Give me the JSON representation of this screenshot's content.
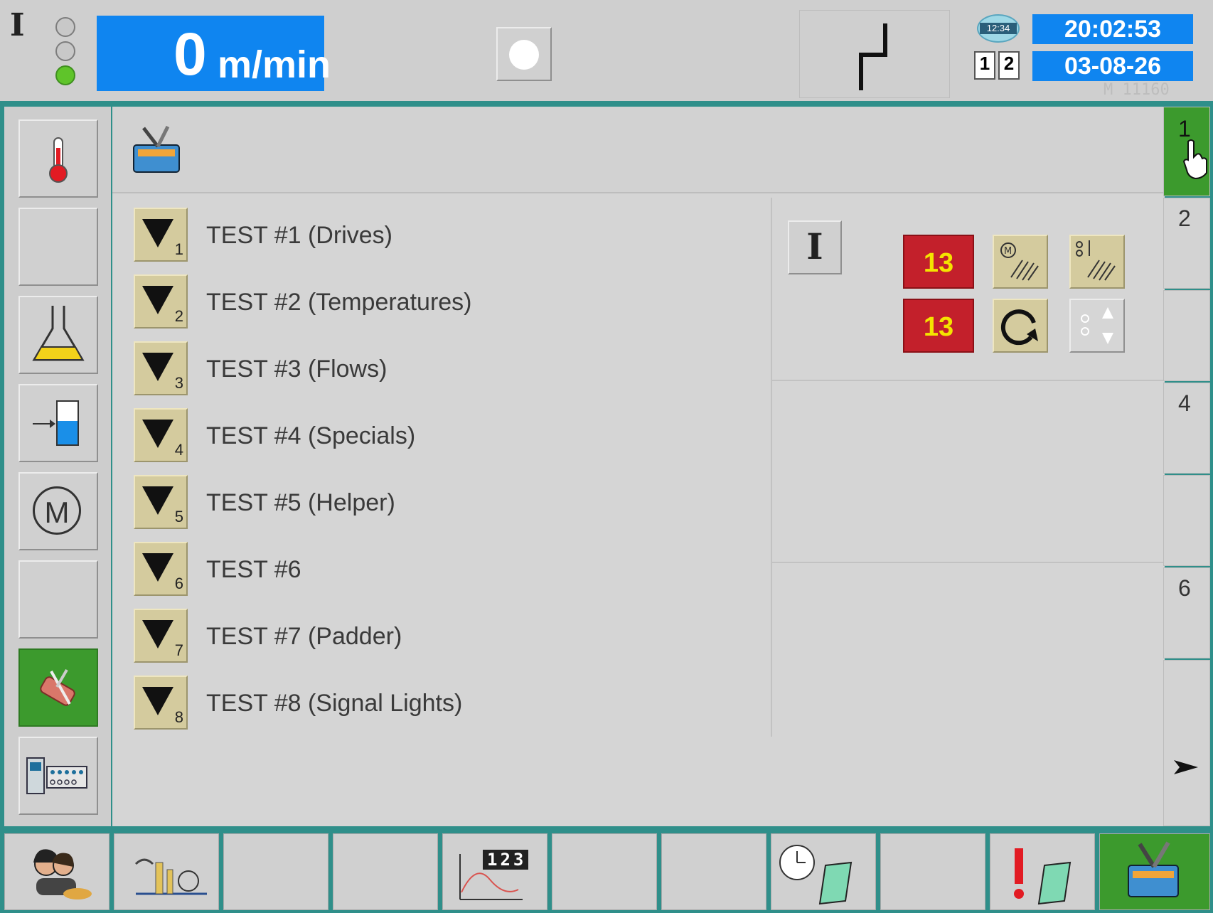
{
  "topbar": {
    "mode_symbol": "I",
    "speed_value": "0",
    "speed_unit": "m/min",
    "time": "20:02:53",
    "date": "03-08-26",
    "clock_icon_text": "12:34",
    "dual_icon_left": "1",
    "dual_icon_right": "2",
    "machine_id": "M 11160"
  },
  "sidebar": {
    "items": [
      {
        "icon": "thermometer-icon"
      },
      {
        "icon": "empty"
      },
      {
        "icon": "flask-icon"
      },
      {
        "icon": "tank-fill-icon"
      },
      {
        "icon": "motor-icon",
        "symbol": "M"
      },
      {
        "icon": "empty"
      },
      {
        "icon": "tools-icon",
        "active": true
      },
      {
        "icon": "control-panel-icon"
      }
    ]
  },
  "tests": [
    {
      "num": "1",
      "label": "TEST #1 (Drives)"
    },
    {
      "num": "2",
      "label": "TEST #2 (Temperatures)"
    },
    {
      "num": "3",
      "label": "TEST #3 (Flows)"
    },
    {
      "num": "4",
      "label": "TEST #4 (Specials)"
    },
    {
      "num": "5",
      "label": "TEST #5 (Helper)"
    },
    {
      "num": "6",
      "label": "TEST #6"
    },
    {
      "num": "7",
      "label": "TEST #7 (Padder)"
    },
    {
      "num": "8",
      "label": "TEST #8 (Signal Lights)"
    }
  ],
  "right_panel": {
    "mode_symbol": "I",
    "counter_top": "13",
    "counter_bottom": "13",
    "motor_symbol": "M"
  },
  "page_tabs": [
    "1",
    "2",
    "",
    "4",
    "",
    "6",
    ""
  ],
  "colors": {
    "accent_green": "#3c9a2d",
    "speed_blue": "#0f85f0",
    "alarm_red": "#c3202b",
    "counter_yellow": "#f4e400",
    "frame_teal": "#2f8f8a"
  },
  "bottombar": {
    "items": [
      {
        "icon": "users-icon"
      },
      {
        "icon": "machine-icon"
      },
      {
        "icon": "empty"
      },
      {
        "icon": "empty"
      },
      {
        "icon": "trend-chart-icon",
        "text": "123"
      },
      {
        "icon": "empty"
      },
      {
        "icon": "empty"
      },
      {
        "icon": "clock-log-icon"
      },
      {
        "icon": "empty"
      },
      {
        "icon": "alarm-log-icon"
      },
      {
        "icon": "toolbox-icon",
        "active": true
      }
    ]
  }
}
